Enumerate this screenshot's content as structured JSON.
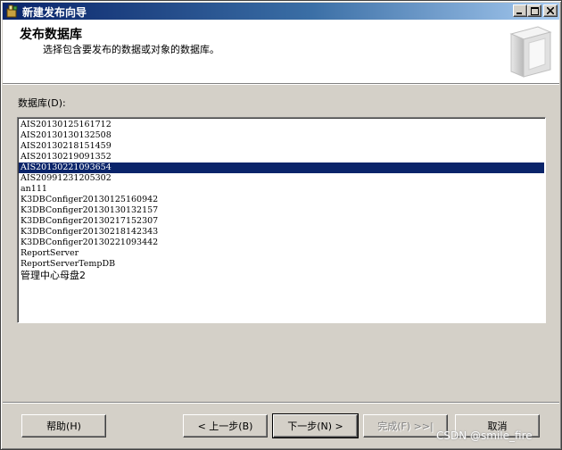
{
  "window": {
    "title": "新建发布向导",
    "controls": {
      "minimize": "minimize-icon",
      "maximize": "maximize-icon",
      "close": "close-icon"
    }
  },
  "header": {
    "title": "发布数据库",
    "subtitle": "选择包含要发布的数据或对象的数据库。",
    "art_icon": "book-icon"
  },
  "database_list": {
    "label": "数据库(D):",
    "items": [
      {
        "name": "AIS20130125161712",
        "selected": false
      },
      {
        "name": "AIS20130130132508",
        "selected": false
      },
      {
        "name": "AIS20130218151459",
        "selected": false
      },
      {
        "name": "AIS20130219091352",
        "selected": false
      },
      {
        "name": "AIS20130221093654",
        "selected": true
      },
      {
        "name": "AIS20991231205302",
        "selected": false
      },
      {
        "name": "an111",
        "selected": false
      },
      {
        "name": "K3DBConfiger20130125160942",
        "selected": false
      },
      {
        "name": "K3DBConfiger20130130132157",
        "selected": false
      },
      {
        "name": "K3DBConfiger20130217152307",
        "selected": false
      },
      {
        "name": "K3DBConfiger20130218142343",
        "selected": false
      },
      {
        "name": "K3DBConfiger20130221093442",
        "selected": false
      },
      {
        "name": "ReportServer",
        "selected": false
      },
      {
        "name": "ReportServerTempDB",
        "selected": false
      },
      {
        "name": "管理中心母盘2",
        "selected": false
      }
    ]
  },
  "buttons": {
    "help": "帮助(H)",
    "back": "< 上一步(B)",
    "next": "下一步(N) >",
    "finish": "完成(F) >>|",
    "cancel": "取消"
  },
  "watermark": "CSDN @smile_fire",
  "colors": {
    "selection": "#0a246a",
    "titlebar": "#0a246a",
    "face": "#d4d0c8"
  }
}
